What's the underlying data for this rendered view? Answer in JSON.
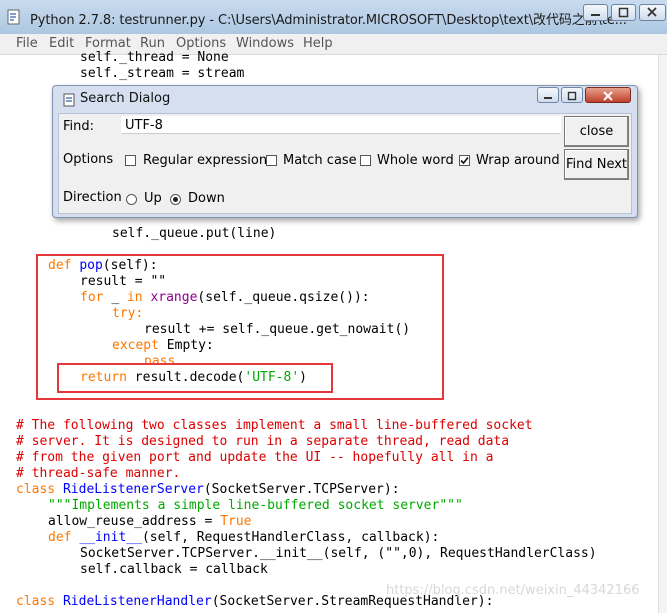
{
  "window": {
    "title": "Python 2.7.8: testrunner.py - C:\\Users\\Administrator.MICROSOFT\\Desktop\\text\\改代码之前\\te..."
  },
  "menu": [
    "File",
    "Edit",
    "Format",
    "Run",
    "Options",
    "Windows",
    "Help"
  ],
  "code": {
    "l01": "self._thread = None",
    "l02": "self._stream = stream",
    "l03": "self._queue.put(line)",
    "l04_def": "def",
    "l04_name": "pop",
    "l04_rest": "(self):",
    "l05": "result = \"\"",
    "l06_for": "for",
    "l06_mid": "_",
    "l06_in": "in",
    "l06_xr": "xrange",
    "l06_rest": "(self._queue.qsize()):",
    "l07": "try:",
    "l08": "result += self._queue.get_nowait()",
    "l09_except": "except",
    "l09_rest": "Empty:",
    "l10": "pass",
    "l11_return": "return",
    "l11_mid": "result.decode(",
    "l11_str": "'UTF-8'",
    "l11_end": ")",
    "c1": "# The following two classes implement a small line-buffered socket",
    "c2": "# server. It is designed to run in a separate thread, read data",
    "c3": "# from the given port and update the UI -- hopefully all in a",
    "c4": "# thread-safe manner.",
    "l16_class": "class",
    "l16_name": "RideListenerServer",
    "l16_rest": "(SocketServer.TCPServer):",
    "l17": "\"\"\"Implements a simple line-buffered socket server\"\"\"",
    "l18_a": "allow_reuse_address =",
    "l18_b": "True",
    "l19_def": "def",
    "l19_name": "__init__",
    "l19_rest": "(self, RequestHandlerClass, callback):",
    "l20": "SocketServer.TCPServer.__init__(self, (\"\",0), RequestHandlerClass)",
    "l21": "self.callback = callback",
    "l22_class": "class",
    "l22_name": "RideListenerHandler",
    "l22_rest": "(SocketServer.StreamRequestHandler):"
  },
  "search_dialog": {
    "title": "Search Dialog",
    "find_label": "Find:",
    "find_value": "UTF-8",
    "close_label": "close",
    "find_next_label": "Find Next",
    "options_label": "Options",
    "regex_label": "Regular expression",
    "regex_checked": false,
    "match_case_label": "Match case",
    "match_case_checked": false,
    "whole_word_label": "Whole word",
    "whole_word_checked": false,
    "wrap_label": "Wrap around",
    "wrap_checked": true,
    "direction_label": "Direction",
    "up_label": "Up",
    "down_label": "Down",
    "selected_direction": "Down"
  },
  "watermark": "https://blog.csdn.net/weixin_44342166",
  "colors": {
    "keyword": "#ff7700",
    "string": "#00aa00",
    "builtin": "#900090",
    "definition": "#0000ff",
    "comment": "#dd0000",
    "highlight_box": "#e5383b"
  }
}
